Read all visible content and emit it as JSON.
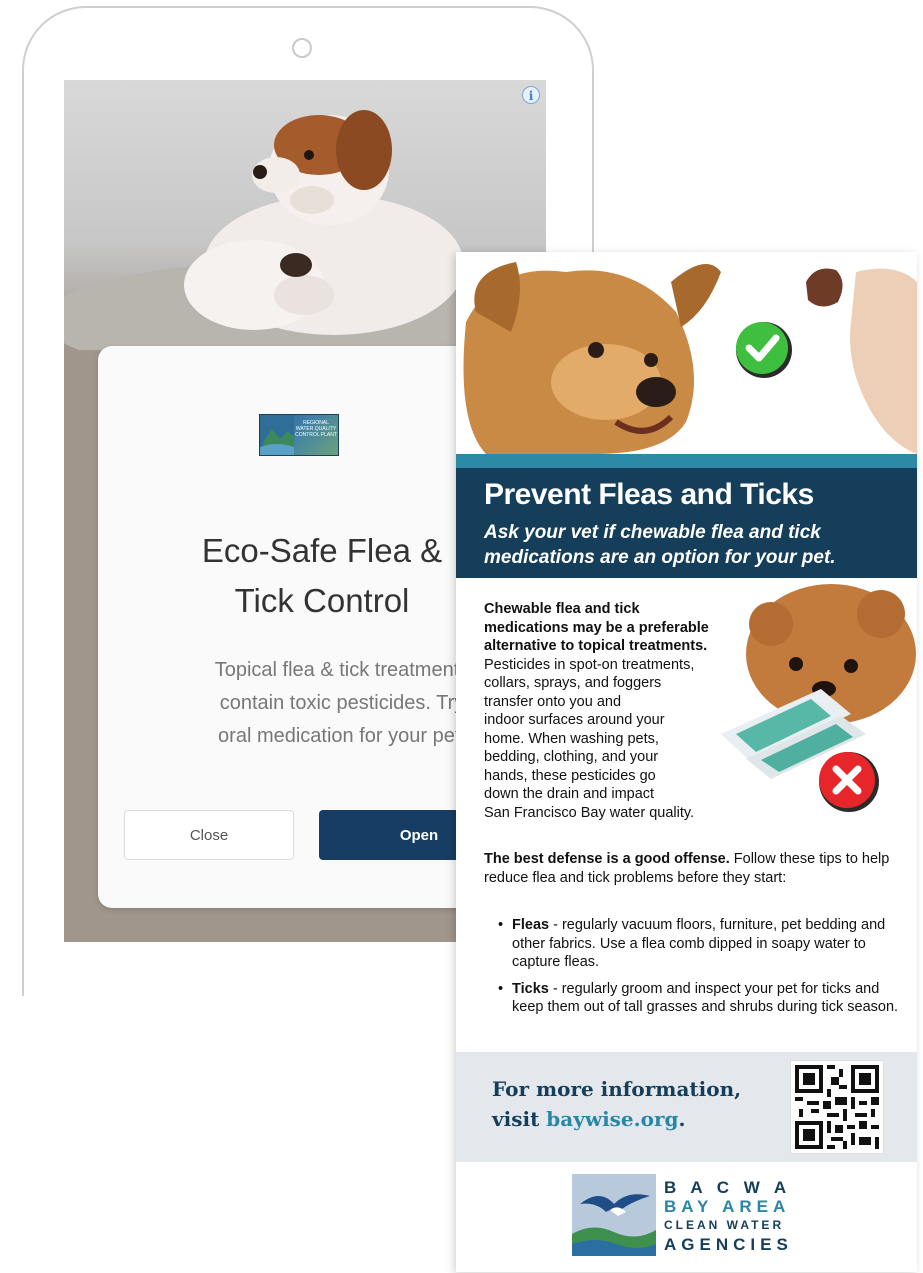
{
  "ad": {
    "info_icon": "i",
    "logo_text": "REGIONAL WATER QUALITY CONTROL PLANT",
    "title": "Eco-Safe Flea &\nTick Control",
    "body": "Topical flea & tick treatments\ncontain toxic pesticides. Try\noral medication for your pet.",
    "close_label": "Close",
    "open_label": "Open"
  },
  "flyer": {
    "title": "Prevent Fleas and Ticks",
    "subtitle": "Ask your vet if chewable flea and tick\nmedications are an option for your pet.",
    "p1_bold": "Chewable flea and tick\nmedications may be a preferable\nalternative to topical treatments.",
    "p1_rest": "\nPesticides in spot-on treatments,\ncollars, sprays, and foggers\ntransfer onto you and\nindoor surfaces around your\nhome. When washing pets,\nbedding, clothing, and your\nhands, these pesticides go\ndown the drain and impact\nSan Francisco Bay water quality.",
    "p2_bold": "The best defense is a good offense.",
    "p2_rest": " Follow these tips to help reduce flea and tick problems before they start:",
    "tips": [
      {
        "term": "Fleas",
        "text": " - regularly vacuum floors, furniture, pet bedding and other fabrics. Use a flea comb dipped in soapy water to capture fleas."
      },
      {
        "term": "Ticks",
        "text": " - regularly groom and inspect your pet for ticks and keep them out of tall grasses and shrubs during tick season."
      }
    ],
    "info_line1": "For more information,",
    "info_visit": "visit ",
    "info_link": "baywise.org",
    "info_period": ".",
    "bacwa_line1": "B A C W A",
    "bacwa_line2": "BAY AREA",
    "bacwa_line3": "CLEAN WATER",
    "bacwa_line4": "AGENCIES"
  },
  "colors": {
    "navy": "#153e5b",
    "teal": "#2c8aa6",
    "open_button": "#163e64",
    "check_green": "#3fbf3f",
    "x_red": "#e6262b"
  }
}
